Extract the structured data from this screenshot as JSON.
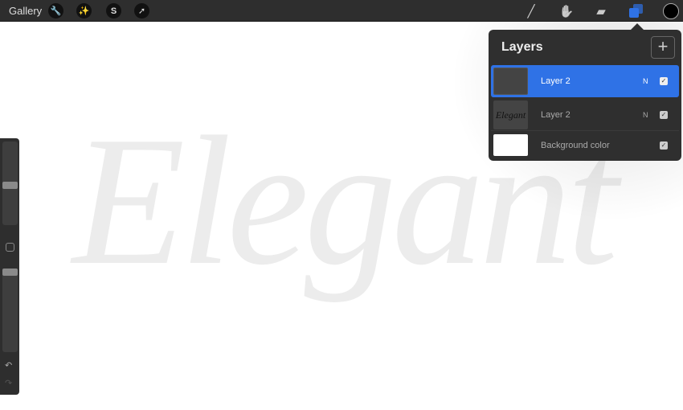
{
  "toolbar": {
    "gallery": "Gallery",
    "left_tools": [
      {
        "icon": "wrench-icon",
        "glyph": "🔧"
      },
      {
        "icon": "magic-wand-icon",
        "glyph": "✨"
      },
      {
        "icon": "selection-icon",
        "glyph": "S"
      },
      {
        "icon": "transform-arrow-icon",
        "glyph": "➚"
      }
    ],
    "right_tools": [
      {
        "icon": "brush-icon",
        "glyph": "╱"
      },
      {
        "icon": "smudge-icon",
        "glyph": "✋"
      },
      {
        "icon": "eraser-icon",
        "glyph": "▰"
      }
    ],
    "accent": "#2f72e6",
    "current_color": "#000000"
  },
  "canvas": {
    "artwork_text": "Elegant"
  },
  "layers": {
    "title": "Layers",
    "add": "+",
    "items": [
      {
        "name": "Layer 2",
        "mode": "N",
        "visible": true,
        "selected": true
      },
      {
        "name": "Layer 2",
        "mode": "N",
        "visible": true,
        "selected": false,
        "thumb_text": "Elegant"
      },
      {
        "name": "Background color",
        "mode": "",
        "visible": true,
        "selected": false
      }
    ]
  },
  "sidebar": {
    "undo": "↶",
    "redo": "↷"
  }
}
